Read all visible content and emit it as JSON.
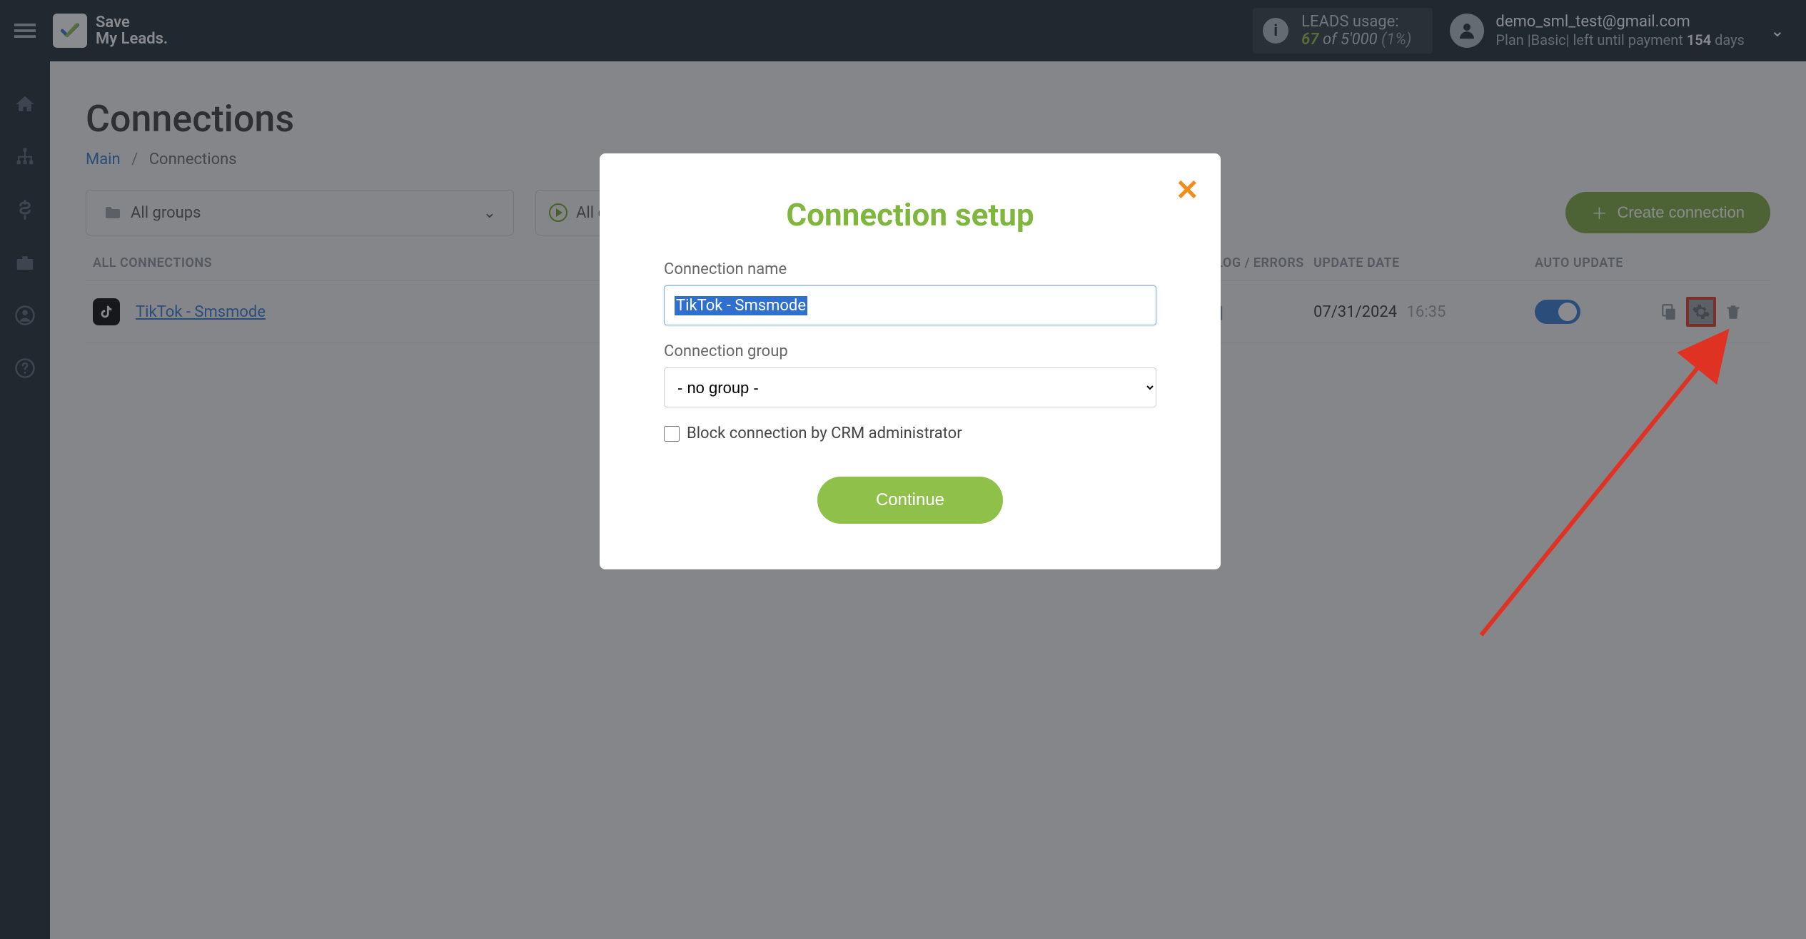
{
  "header": {
    "brand_line1": "Save",
    "brand_line2": "My Leads.",
    "leads_label": "LEADS usage:",
    "leads_used": "67",
    "leads_of": "of",
    "leads_total": "5'000",
    "leads_pct": "(1%)",
    "user_email": "demo_sml_test@gmail.com",
    "user_plan_prefix": "Plan |Basic| left until payment ",
    "user_plan_days_num": "154",
    "user_plan_days_suffix": " days"
  },
  "page": {
    "title": "Connections",
    "breadcrumb_main": "Main",
    "breadcrumb_current": "Connections",
    "group_select_label": "All groups",
    "select_all_label": "All connections",
    "create_button": "Create connection"
  },
  "table": {
    "col_name": "ALL CONNECTIONS",
    "col_log": "LOG / ERRORS",
    "col_date": "UPDATE DATE",
    "col_auto": "AUTO UPDATE",
    "rows": [
      {
        "name": "TikTok - Smsmode",
        "date": "07/31/2024",
        "time": "16:35",
        "auto_update": true
      }
    ]
  },
  "modal": {
    "title": "Connection setup",
    "name_label": "Connection name",
    "name_value": "TikTok - Smsmode",
    "group_label": "Connection group",
    "group_value": "- no group -",
    "block_label": "Block connection by CRM administrator",
    "continue": "Continue"
  }
}
